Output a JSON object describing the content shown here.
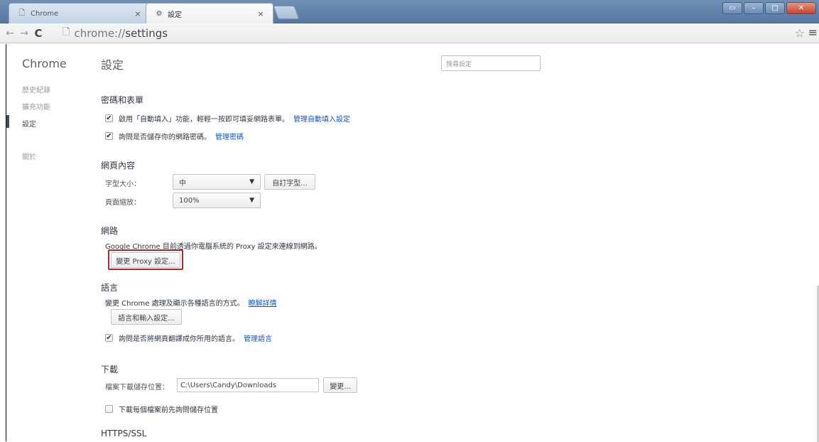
{
  "tabs": [
    {
      "title": "Chrome",
      "close": "×"
    },
    {
      "title": "設定",
      "close": "×"
    }
  ],
  "window_controls": {
    "restore": "▭",
    "minimize": "–",
    "maximize": "□",
    "close": "✕"
  },
  "toolbar": {
    "back": "←",
    "forward": "→",
    "reload": "C",
    "url_scheme": "chrome://",
    "url_path": "settings",
    "star": "☆",
    "menu": "≡"
  },
  "nav": {
    "title": "Chrome",
    "items": [
      {
        "label": "歷史紀錄"
      },
      {
        "label": "擴充功能"
      },
      {
        "label": "設定"
      },
      {
        "label": "關於"
      }
    ]
  },
  "header": {
    "title": "設定",
    "search_placeholder": "搜尋設定"
  },
  "passwords_forms": {
    "title": "密碼和表單",
    "autofill_label": "啟用「自動填入」功能，輕輕一按即可填妥網路表單。",
    "autofill_link": "管理自動填入設定",
    "passwords_label": "詢問是否儲存你的網路密碼。",
    "passwords_link": "管理密碼"
  },
  "web_content": {
    "title": "網頁內容",
    "font_size_label": "字型大小：",
    "font_size_value": "中",
    "customize_fonts": "自訂字型...",
    "zoom_label": "頁面縮放：",
    "zoom_value": "100%"
  },
  "network": {
    "title": "網路",
    "description": "Google Chrome 目前透過你電腦系統的 Proxy 設定來連線到網路。",
    "proxy_button": "變更 Proxy 設定..."
  },
  "languages": {
    "title": "語言",
    "description": "變更 Chrome 處理及顯示各種語言的方式。",
    "learn_more": "瞭解詳情",
    "input_button": "語言和輸入設定...",
    "translate_label": "詢問是否將網頁翻譯成你所用的語言。",
    "translate_link": "管理語言"
  },
  "downloads": {
    "title": "下載",
    "location_label": "檔案下載儲存位置：",
    "location_value": "C:\\Users\\Candy\\Downloads",
    "change_button": "變更...",
    "ask_label": "下載每個檔案前先詢問儲存位置"
  },
  "https": {
    "title": "HTTPS/SSL"
  },
  "checkmark": "✔"
}
